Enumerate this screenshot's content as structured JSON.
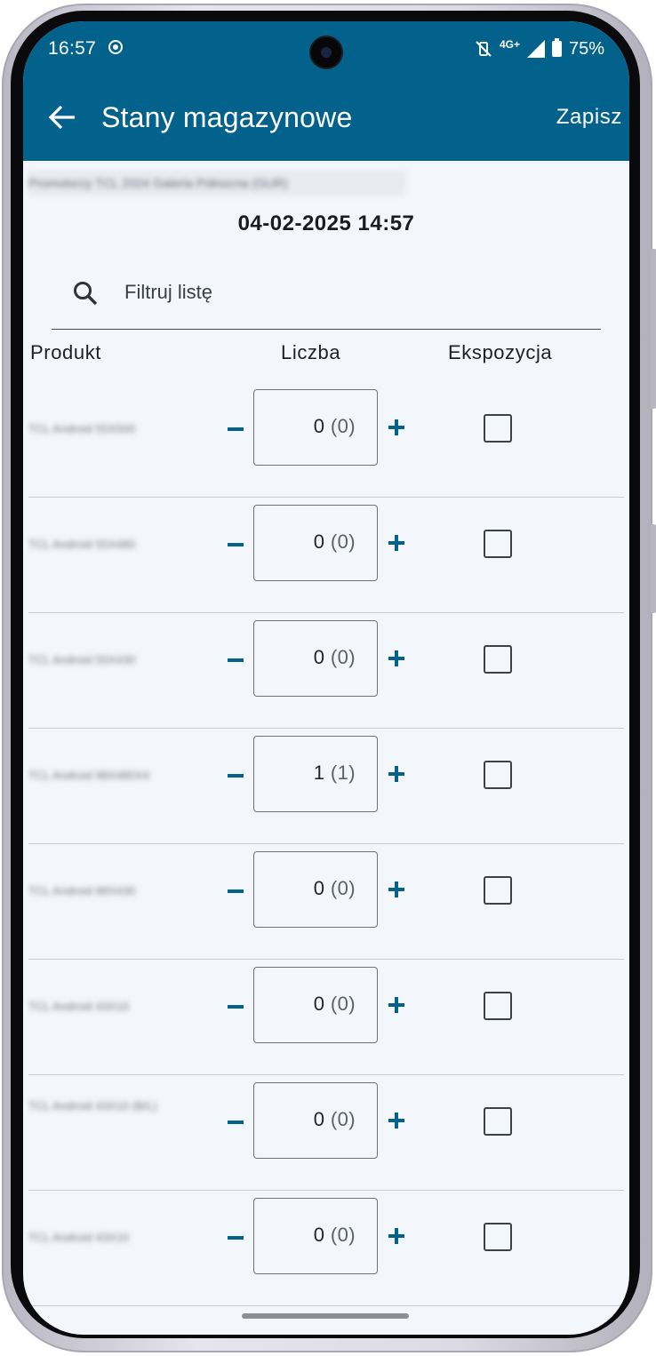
{
  "status_bar": {
    "time": "16:57",
    "network": "4G+",
    "battery": "75%"
  },
  "app_bar": {
    "title": "Stany magazynowe",
    "save_label": "Zapisz"
  },
  "location": "Promotorzy TCL 2024 Galeria Północna (GUR)",
  "datetime": "04-02-2025  14:57",
  "search": {
    "placeholder": "Filtruj listę",
    "value": ""
  },
  "columns": {
    "product": "Produkt",
    "count": "Liczba",
    "exposure": "Ekspozycja"
  },
  "rows": [
    {
      "product": "TCL Android 55X500",
      "quantity": "0",
      "quantity_paren": "(0)",
      "exposure": false
    },
    {
      "product": "TCL Android 55X480",
      "quantity": "0",
      "quantity_paren": "(0)",
      "exposure": false
    },
    {
      "product": "TCL Android 55X430",
      "quantity": "0",
      "quantity_paren": "(0)",
      "exposure": false
    },
    {
      "product": "TCL Android 98X480X4",
      "quantity": "1",
      "quantity_paren": "(1)",
      "exposure": false
    },
    {
      "product": "TCL Android 98X430",
      "quantity": "0",
      "quantity_paren": "(0)",
      "exposure": false
    },
    {
      "product": "TCL Android 43X10",
      "quantity": "0",
      "quantity_paren": "(0)",
      "exposure": false
    },
    {
      "product": "TCL Android 43X10 (B/L)",
      "quantity": "0",
      "quantity_paren": "(0)",
      "exposure": false
    },
    {
      "product": "TCL Android 43X10",
      "quantity": "0",
      "quantity_paren": "(0)",
      "exposure": false
    }
  ],
  "colors": {
    "primary": "#03628c",
    "background": "#f3f6fb",
    "on_primary": "#ffffff"
  }
}
